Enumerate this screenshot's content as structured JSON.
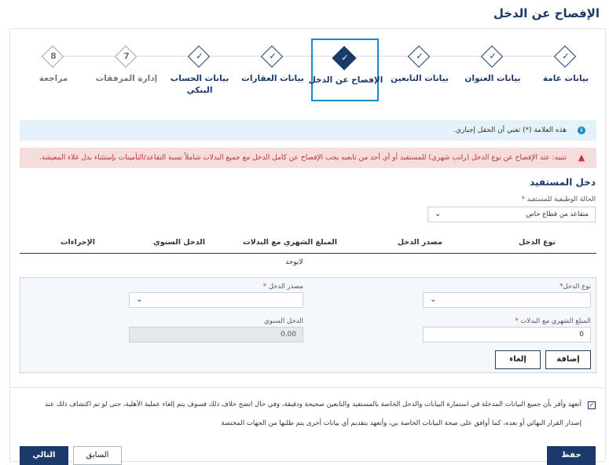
{
  "page": {
    "title": "الإفصاح عن الدخل"
  },
  "steps": [
    {
      "label": "بيانات عامة",
      "glyph": "✓",
      "state": "done"
    },
    {
      "label": "بيانات العنوان",
      "glyph": "✓",
      "state": "done"
    },
    {
      "label": "بيانات التابعين",
      "glyph": "✓",
      "state": "done"
    },
    {
      "label": "الإفصاح عن الدخل",
      "glyph": "✓",
      "state": "active"
    },
    {
      "label": "بيانات العقارات",
      "glyph": "✓",
      "state": "done"
    },
    {
      "label": "بيانات الحساب البنكي",
      "glyph": "✓",
      "state": "done"
    },
    {
      "label": "إدارة المرفقات",
      "glyph": "7",
      "state": "future"
    },
    {
      "label": "مراجعة",
      "glyph": "8",
      "state": "future"
    }
  ],
  "alerts": {
    "info": "هذه العلامة (*) تعني أن الحقل إجباري.",
    "warning": "تنبيه: عند الإفصاح عن نوع الدخل (راتب شهري) للمستفيد أو أي أحد من تابعيه يجب الإفصاح عن كامل الدخل مع جميع البدلات شاملاً نسبة التقاعد/التأمينات بإستثناء بدل غلاء المعيشة."
  },
  "beneficiary": {
    "section_title": "دخل المستفيد",
    "employment_label": "الحالة الوظيفية للمستفيد",
    "employment_value": "متقاعد من قطاع خاص",
    "required_mark": "*"
  },
  "table": {
    "headers": [
      "نوع الدخل",
      "مصدر الدخل",
      "المبلغ الشهري مع البدلات",
      "الدخل السنوي",
      "الإجراءات"
    ],
    "empty_text": "لايوجد"
  },
  "form": {
    "income_type_label": "نوع الدخل",
    "income_source_label": "مصدر الدخل",
    "monthly_label": "المبلغ الشهري مع البدلات",
    "monthly_value": "0",
    "annual_label": "الدخل السنوي",
    "annual_value": "0.00",
    "add_button": "إضافة",
    "cancel_button": "إلغاء"
  },
  "consent": {
    "line1": "أتعهد وأقر بأن جميع البيانات المدخلة في استمارة البيانات والدخل الخاصة بالمستفيد والتابعين صحيحة ودقيقة، وفي حال اتضح خلاف ذلك فسوف يتم إلغاء عملية الأهلية، حتى لو تم اكتشاف ذلك عند",
    "line2": "إصدار القرار النهائي أو بعده، كما أوافق على صحة البيانات الخاصة بي، وأتعهد بتقديم أي بيانات أخرى يتم طلبها من الجهات المختصة",
    "checked": "✓"
  },
  "footer": {
    "save": "حفظ",
    "previous": "السابق",
    "next": "التالي"
  },
  "colors": {
    "primary": "#1b3a6b",
    "accent": "#1e88c9",
    "warning_bg": "#f6dcdc"
  }
}
